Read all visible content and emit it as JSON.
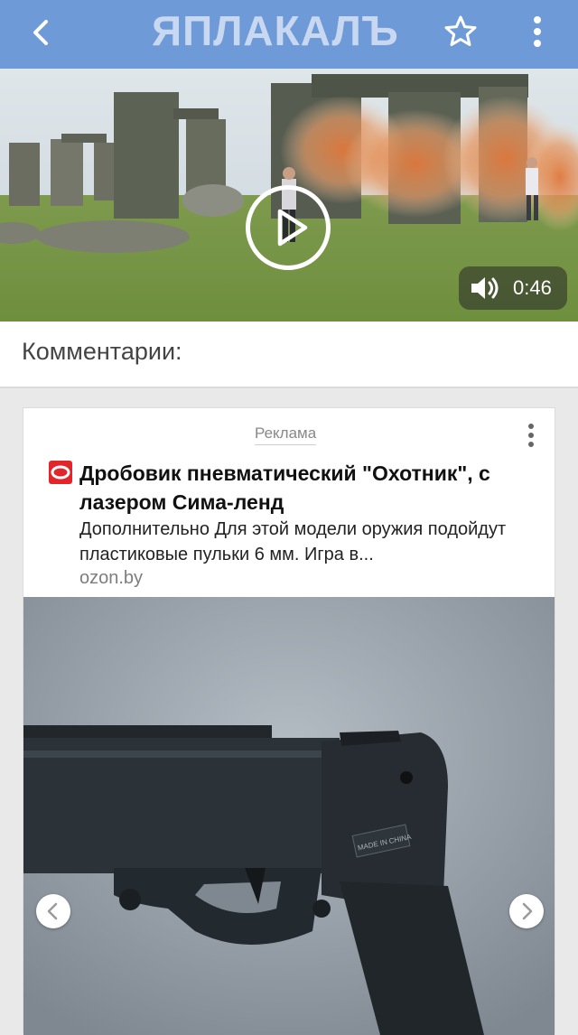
{
  "header": {
    "logo_text": "ЯПЛАКАЛЪ",
    "bg_color": "#6f9ad8",
    "icons": [
      "chevron-left-icon",
      "star-icon",
      "more-vertical-icon"
    ]
  },
  "video": {
    "duration": "0:46",
    "icons": [
      "play-icon",
      "volume-icon"
    ]
  },
  "comments": {
    "title": "Комментарии:"
  },
  "ad": {
    "label": "Реклама",
    "title": "Дробовик пневматический \"Охотник\", с лазером Сима-ленд",
    "description": "Дополнительно Для этой модели оружия подойдут пластиковые пульки 6 мм. Игра в...",
    "domain": "ozon.by",
    "image_text": "MADE IN CHINA",
    "icons": [
      "more-vertical-icon",
      "ozon-favicon-icon",
      "chevron-left-icon",
      "chevron-right-icon"
    ]
  }
}
